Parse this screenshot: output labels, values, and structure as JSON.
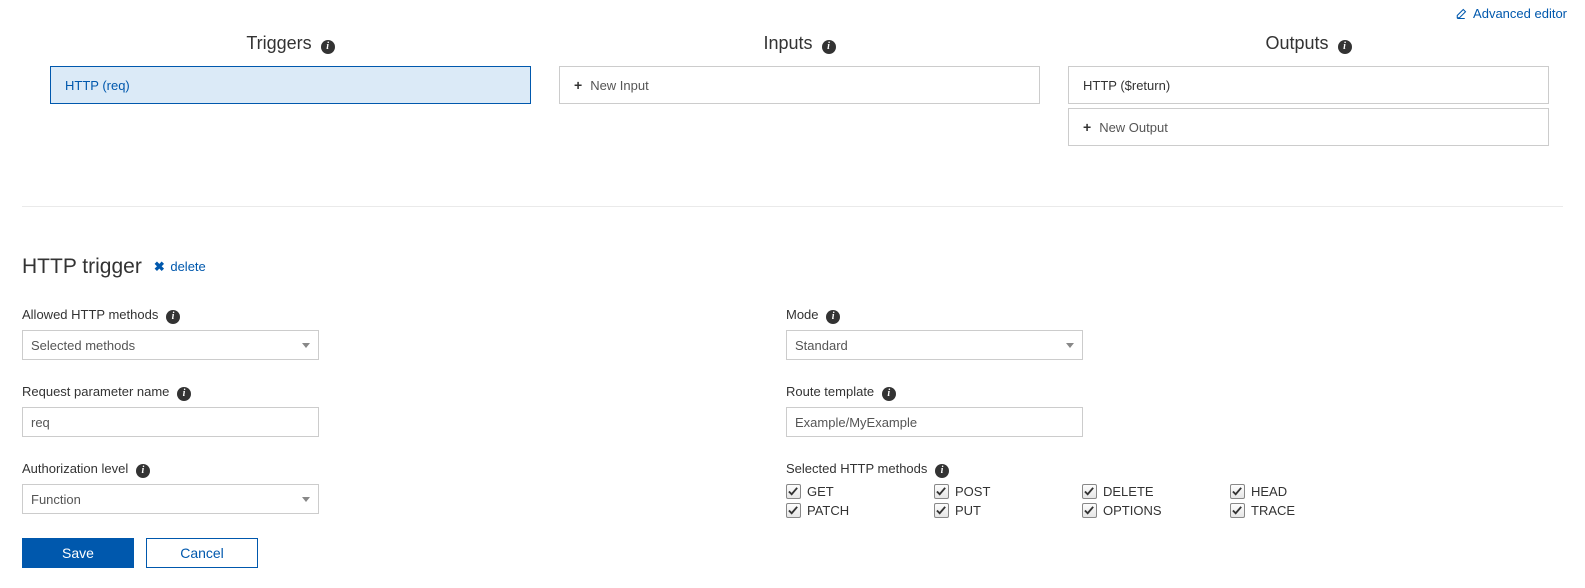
{
  "advancedEditor": "Advanced editor",
  "columns": {
    "triggers": {
      "title": "Triggers",
      "item": "HTTP (req)"
    },
    "inputs": {
      "title": "Inputs",
      "add": "New Input"
    },
    "outputs": {
      "title": "Outputs",
      "item": "HTTP ($return)",
      "add": "New Output"
    }
  },
  "detail": {
    "title": "HTTP trigger",
    "deleteLabel": "delete",
    "allowedMethodsLabel": "Allowed HTTP methods",
    "allowedMethodsValue": "Selected methods",
    "paramNameLabel": "Request parameter name",
    "paramNameValue": "req",
    "authLevelLabel": "Authorization level",
    "authLevelValue": "Function",
    "modeLabel": "Mode",
    "modeValue": "Standard",
    "routeLabel": "Route template",
    "routeValue": "Example/MyExample",
    "selectedMethodsLabel": "Selected HTTP methods",
    "methods": {
      "get": "GET",
      "post": "POST",
      "delete": "DELETE",
      "head": "HEAD",
      "patch": "PATCH",
      "put": "PUT",
      "options": "OPTIONS",
      "trace": "TRACE"
    },
    "saveLabel": "Save",
    "cancelLabel": "Cancel"
  }
}
